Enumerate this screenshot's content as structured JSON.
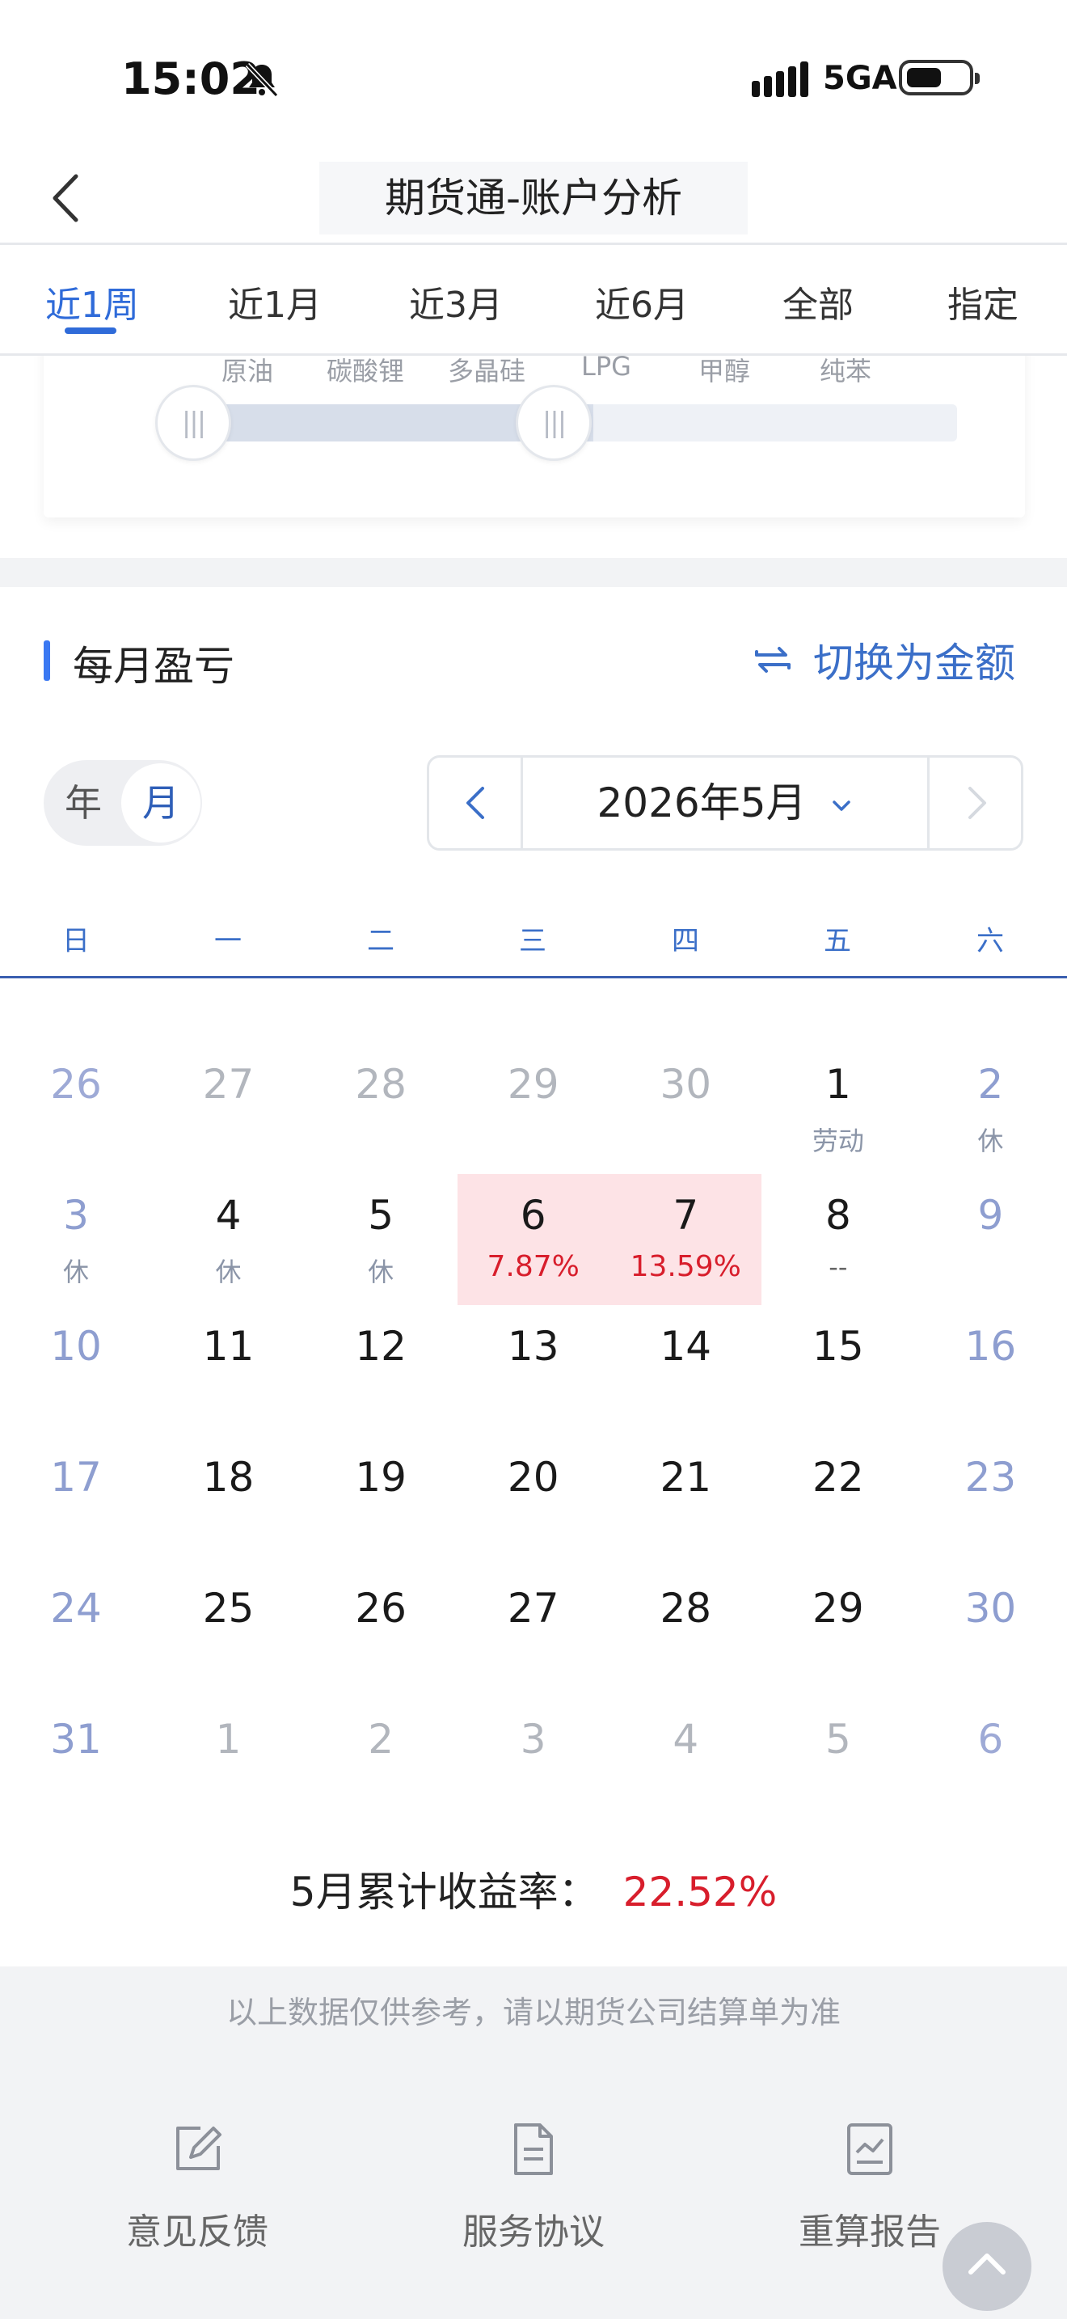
{
  "status_bar": {
    "time": "15:02",
    "network": "5GA"
  },
  "nav": {
    "title": "期货通-账户分析"
  },
  "tabs": [
    "近1周",
    "近1月",
    "近3月",
    "近6月",
    "全部",
    "指定"
  ],
  "active_tab": 0,
  "filter_card": {
    "cut_labels": [
      "原油",
      "碳酸锂",
      "多晶硅",
      "LPG",
      "甲醇",
      "纯苯"
    ]
  },
  "monthly": {
    "title": "每月盈亏",
    "switch_label": "切换为金额",
    "toggle": {
      "year": "年",
      "month": "月"
    },
    "selected_month": "2026年5月",
    "weekdays": [
      "日",
      "一",
      "二",
      "三",
      "四",
      "五",
      "六"
    ],
    "weeks": [
      [
        {
          "d": "26",
          "out": true
        },
        {
          "d": "27",
          "out": true
        },
        {
          "d": "28",
          "out": true
        },
        {
          "d": "29",
          "out": true
        },
        {
          "d": "30",
          "out": true
        },
        {
          "d": "1",
          "sub": "劳动"
        },
        {
          "d": "2",
          "sub": "休"
        }
      ],
      [
        {
          "d": "3",
          "sub": "休"
        },
        {
          "d": "4",
          "sub": "休"
        },
        {
          "d": "5",
          "sub": "休"
        },
        {
          "d": "6",
          "pct": "7.87%",
          "hl": true
        },
        {
          "d": "7",
          "pct": "13.59%",
          "hl": true
        },
        {
          "d": "8",
          "dash": "--"
        },
        {
          "d": "9"
        }
      ],
      [
        {
          "d": "10"
        },
        {
          "d": "11"
        },
        {
          "d": "12"
        },
        {
          "d": "13"
        },
        {
          "d": "14"
        },
        {
          "d": "15"
        },
        {
          "d": "16"
        }
      ],
      [
        {
          "d": "17"
        },
        {
          "d": "18"
        },
        {
          "d": "19"
        },
        {
          "d": "20"
        },
        {
          "d": "21"
        },
        {
          "d": "22"
        },
        {
          "d": "23"
        }
      ],
      [
        {
          "d": "24"
        },
        {
          "d": "25"
        },
        {
          "d": "26"
        },
        {
          "d": "27"
        },
        {
          "d": "28"
        },
        {
          "d": "29"
        },
        {
          "d": "30"
        }
      ],
      [
        {
          "d": "31"
        },
        {
          "d": "1",
          "out": true
        },
        {
          "d": "2",
          "out": true
        },
        {
          "d": "3",
          "out": true
        },
        {
          "d": "4",
          "out": true
        },
        {
          "d": "5",
          "out": true
        },
        {
          "d": "6",
          "out": true
        }
      ]
    ],
    "summary_label": "5月累计收益率：",
    "summary_value": "22.52%"
  },
  "footer": {
    "disclaimer": "以上数据仅供参考，请以期货公司结算单为准",
    "items": [
      {
        "label": "意见反馈",
        "icon": "edit-icon"
      },
      {
        "label": "服务协议",
        "icon": "document-icon"
      },
      {
        "label": "重算报告",
        "icon": "report-icon"
      }
    ]
  },
  "colors": {
    "accent": "#2f6bd9",
    "positive": "#d81e2c",
    "highlight_bg": "#fde3e6"
  }
}
